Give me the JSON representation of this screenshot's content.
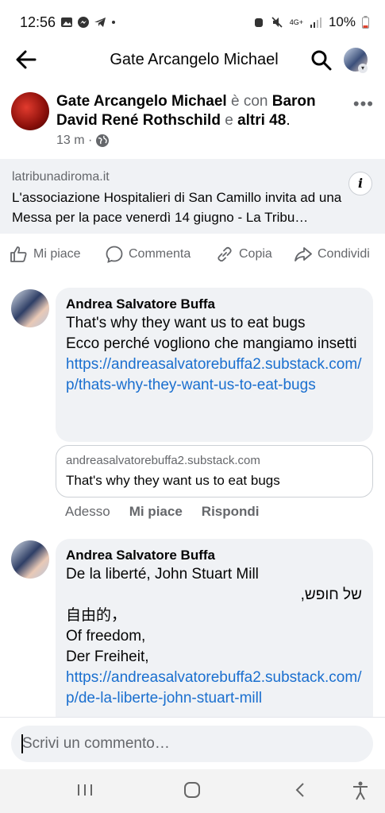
{
  "status": {
    "time": "12:56",
    "left_icons": [
      "gallery-icon",
      "messenger-icon",
      "telegram-icon",
      "dot-icon"
    ],
    "network": "4G+",
    "battery": "10%"
  },
  "header": {
    "title": "Gate Arcangelo Michael"
  },
  "post": {
    "author": "Gate Arcangelo Michael",
    "with_word": "è con",
    "tagged": "Baron David René Rothschild",
    "and_word": "e",
    "others": "altri 48",
    "time": "13 m ·",
    "link": {
      "domain": "latribunadiroma.it",
      "title": "L'associazione Hospitalieri di San Camillo invita ad una Messa per la pace venerdì 14 giugno - La Tribu…",
      "info": "i"
    },
    "actions": {
      "like": "Mi piace",
      "comment": "Commenta",
      "copy": "Copia",
      "share": "Condividi"
    }
  },
  "comments": [
    {
      "author": "Andrea Salvatore Buffa",
      "lines": [
        "That's why they want us to eat bugs",
        "Ecco perché vogliono che mangiamo insetti"
      ],
      "link": "https://andreasalvatorebuffa2.substack.com/p/thats-why-they-want-us-to-eat-bugs",
      "preview": {
        "domain": "andreasalvatorebuffa2.substack.com",
        "title": "That's why they want us to eat bugs"
      },
      "time": "Adesso",
      "like": "Mi piace",
      "reply": "Rispondi"
    },
    {
      "author": "Andrea Salvatore Buffa",
      "line1": "De la liberté, John Stuart Mill",
      "line_rtl": "של חופש,",
      "line3": "自由的，",
      "line4": "Of freedom,",
      "line5": "Der Freiheit,",
      "link": "https://andreasalvatorebuffa2.substack.com/p/de-la-liberte-john-stuart-mill"
    }
  ],
  "composer": {
    "placeholder": "Scrivi un commento…"
  },
  "nav": [
    "recents-icon",
    "home-icon",
    "back-icon",
    "accessibility-icon"
  ]
}
